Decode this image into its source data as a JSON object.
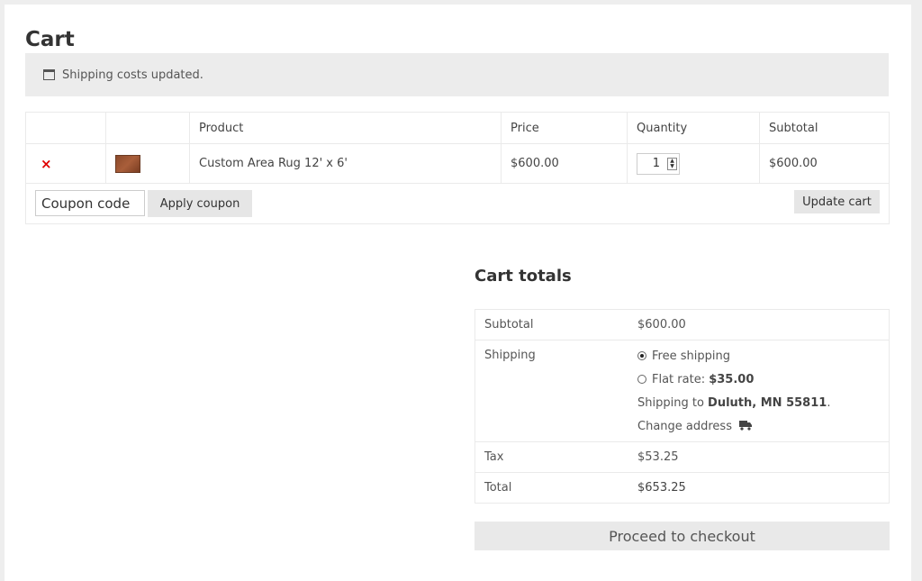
{
  "page": {
    "title": "Cart"
  },
  "notice": {
    "icon": "calendar-icon",
    "text": "Shipping costs updated."
  },
  "cart_table": {
    "headers": {
      "product": "Product",
      "price": "Price",
      "quantity": "Quantity",
      "subtotal": "Subtotal"
    },
    "items": [
      {
        "remove_icon": "×",
        "name": "Custom Area Rug 12' x 6'",
        "price": "$600.00",
        "quantity": "1",
        "subtotal": "$600.00"
      }
    ],
    "coupon_placeholder": "Coupon code",
    "apply_coupon_label": "Apply coupon",
    "update_cart_label": "Update cart"
  },
  "totals": {
    "title": "Cart totals",
    "subtotal_label": "Subtotal",
    "subtotal_value": "$600.00",
    "shipping_label": "Shipping",
    "free_shipping_label": "Free shipping",
    "flat_rate_label": "Flat rate:",
    "flat_rate_value": "$35.00",
    "shipping_to_prefix": "Shipping to",
    "shipping_to_location": "Duluth, MN 55811",
    "shipping_to_suffix": ".",
    "change_address_label": "Change address",
    "tax_label": "Tax",
    "tax_value": "$53.25",
    "total_label": "Total",
    "total_value": "$653.25"
  },
  "checkout": {
    "label": "Proceed to checkout"
  }
}
